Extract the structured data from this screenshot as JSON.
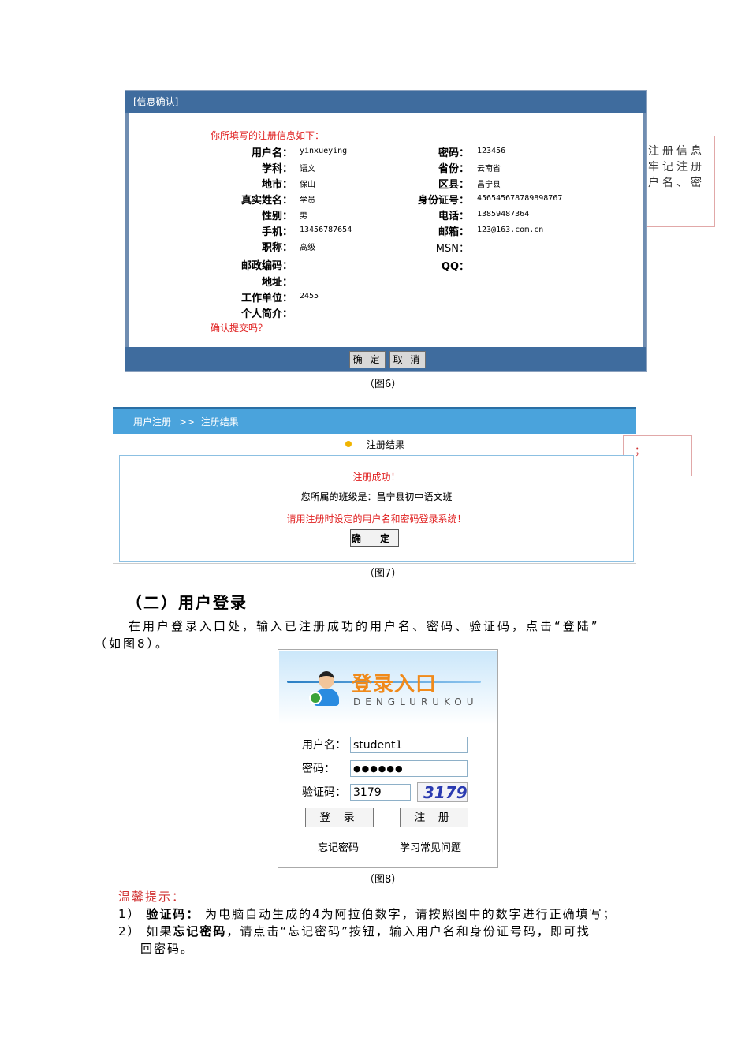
{
  "fig6": {
    "window_title": "[信息确认]",
    "intro": "你所填写的注册信息如下：",
    "left_fields": [
      {
        "label": "用户名：",
        "value": "yinxueying"
      },
      {
        "label": "学科：",
        "value": "语文"
      },
      {
        "label": "地市：",
        "value": "保山"
      },
      {
        "label": "真实姓名：",
        "value": "学员"
      },
      {
        "label": "性别：",
        "value": "男"
      },
      {
        "label": "手机：",
        "value": "13456787654"
      },
      {
        "label": "职称：",
        "value": "高级"
      },
      {
        "label": "邮政编码：",
        "value": ""
      },
      {
        "label": "地址：",
        "value": ""
      },
      {
        "label": "工作单位：",
        "value": "2455"
      },
      {
        "label": "个人简介：",
        "value": ""
      }
    ],
    "right_fields": [
      {
        "label": "密码：",
        "value": "123456"
      },
      {
        "label": "省份：",
        "value": "云南省"
      },
      {
        "label": "区县：",
        "value": "昌宁县"
      },
      {
        "label": "身份证号：",
        "value": "456545678789898767"
      },
      {
        "label": "电话：",
        "value": "13859487364"
      },
      {
        "label": "邮箱：",
        "value": "123@163.com.cn"
      },
      {
        "label": "MSN：",
        "value": ""
      },
      {
        "label": "QQ：",
        "value": ""
      }
    ],
    "confirm_question": "确认提交吗？",
    "ok_button": "确 定",
    "cancel_button": "取 消",
    "side_lines": [
      "注册信息",
      "牢记注册",
      "户名、密"
    ],
    "caption": "（图6）"
  },
  "fig7": {
    "breadcrumb_home": "用户注册",
    "breadcrumb_sep": ">>",
    "breadcrumb_current": "注册结果",
    "section_title": "注册结果",
    "success": "注册成功！",
    "class_info": "您所属的班级是：昌宁县初中语文班",
    "login_hint": "请用注册时设定的用户名和密码登录系统！",
    "ok_button": "确 定",
    "side_text": "；",
    "caption": "（图7）"
  },
  "section": {
    "heading": "（二）用户登录",
    "para_line1": "在用户登录入口处，输入已注册成功的用户名、密码、验证码，点击“登陆”",
    "para_line2": "（如图8）。"
  },
  "fig8": {
    "logo_cn": "登录入口",
    "logo_pinyin": "DENGLURUKOU",
    "username_label": "用户名：",
    "username_value": "student1",
    "password_label": "密码：",
    "password_value": "●●●●●●",
    "captcha_label": "验证码：",
    "captcha_value": "3179",
    "captcha_image_text": "3179",
    "login_button": "登 录",
    "register_button": "注 册",
    "forgot_link": "忘记密码",
    "faq_link": "学习常见问题",
    "caption": "（图8）"
  },
  "tips": {
    "title": "温馨提示：",
    "item1_num": "1）",
    "item1_bold": "验证码：",
    "item1_text": "为电脑自动生成的4为阿拉伯数字，请按照图中的数字进行正确填写；",
    "item2_num": "2）",
    "item2_pre": "如果",
    "item2_bold": "忘记密码",
    "item2_text": "，请点击“忘记密码”按钮，输入用户名和身份证号码，即可找",
    "item2_line2": "回密码。"
  }
}
